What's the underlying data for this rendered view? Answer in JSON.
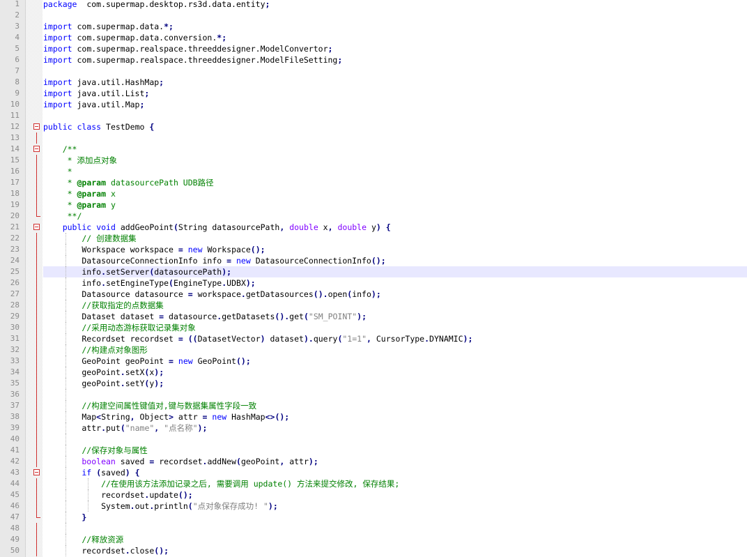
{
  "editor": {
    "current_line": 25,
    "colors": {
      "gutter_bg": "#e8e8e8",
      "current_line_bg": "#e8e8ff",
      "keyword": "#0000ff",
      "type_keyword": "#8000ff",
      "comment": "#008000",
      "string": "#808080",
      "fold_marker": "#d03030"
    },
    "lines": [
      {
        "n": 1,
        "indent": 0,
        "tokens": [
          [
            "kw",
            "package"
          ],
          [
            "",
            "  com.supermap.desktop.rs3d.data.entity"
          ],
          [
            "op",
            ";"
          ]
        ]
      },
      {
        "n": 2,
        "indent": 0,
        "tokens": []
      },
      {
        "n": 3,
        "indent": 0,
        "tokens": [
          [
            "kw",
            "import"
          ],
          [
            "",
            " com.supermap.data."
          ],
          [
            "op",
            "*;"
          ]
        ]
      },
      {
        "n": 4,
        "indent": 0,
        "tokens": [
          [
            "kw",
            "import"
          ],
          [
            "",
            " com.supermap.data.conversion."
          ],
          [
            "op",
            "*;"
          ]
        ]
      },
      {
        "n": 5,
        "indent": 0,
        "tokens": [
          [
            "kw",
            "import"
          ],
          [
            "",
            " com.supermap.realspace.threeddesigner.ModelConvertor"
          ],
          [
            "op",
            ";"
          ]
        ]
      },
      {
        "n": 6,
        "indent": 0,
        "tokens": [
          [
            "kw",
            "import"
          ],
          [
            "",
            " com.supermap.realspace.threeddesigner.ModelFileSetting"
          ],
          [
            "op",
            ";"
          ]
        ]
      },
      {
        "n": 7,
        "indent": 0,
        "tokens": []
      },
      {
        "n": 8,
        "indent": 0,
        "tokens": [
          [
            "kw",
            "import"
          ],
          [
            "",
            " java.util.HashMap"
          ],
          [
            "op",
            ";"
          ]
        ]
      },
      {
        "n": 9,
        "indent": 0,
        "tokens": [
          [
            "kw",
            "import"
          ],
          [
            "",
            " java.util.List"
          ],
          [
            "op",
            ";"
          ]
        ]
      },
      {
        "n": 10,
        "indent": 0,
        "tokens": [
          [
            "kw",
            "import"
          ],
          [
            "",
            " java.util.Map"
          ],
          [
            "op",
            ";"
          ]
        ]
      },
      {
        "n": 11,
        "indent": 0,
        "tokens": []
      },
      {
        "n": 12,
        "indent": 0,
        "fold": "start",
        "tokens": [
          [
            "kw",
            "public"
          ],
          [
            "",
            " "
          ],
          [
            "kw",
            "class"
          ],
          [
            "",
            " TestDemo "
          ],
          [
            "op",
            "{"
          ]
        ]
      },
      {
        "n": 13,
        "indent": 0,
        "fold": "line",
        "tokens": []
      },
      {
        "n": 14,
        "indent": 1,
        "fold": "start",
        "tokens": [
          [
            "cm",
            "    /**"
          ]
        ]
      },
      {
        "n": 15,
        "indent": 1,
        "fold": "line",
        "tokens": [
          [
            "cm",
            "     * 添加点对象"
          ]
        ]
      },
      {
        "n": 16,
        "indent": 1,
        "fold": "line",
        "tokens": [
          [
            "cm",
            "     *"
          ]
        ]
      },
      {
        "n": 17,
        "indent": 1,
        "fold": "line",
        "tokens": [
          [
            "cm",
            "     * "
          ],
          [
            "cmb",
            "@param"
          ],
          [
            "cm",
            " datasourcePath UDB路径"
          ]
        ]
      },
      {
        "n": 18,
        "indent": 1,
        "fold": "line",
        "tokens": [
          [
            "cm",
            "     * "
          ],
          [
            "cmb",
            "@param"
          ],
          [
            "cm",
            " x"
          ]
        ]
      },
      {
        "n": 19,
        "indent": 1,
        "fold": "line",
        "tokens": [
          [
            "cm",
            "     * "
          ],
          [
            "cmb",
            "@param"
          ],
          [
            "cm",
            " y"
          ]
        ]
      },
      {
        "n": 20,
        "indent": 1,
        "fold": "end",
        "tokens": [
          [
            "cm",
            "     **/"
          ]
        ]
      },
      {
        "n": 21,
        "indent": 1,
        "fold": "start",
        "tokens": [
          [
            "",
            ""
          ],
          [
            "kw",
            "    public"
          ],
          [
            "",
            " "
          ],
          [
            "kw",
            "void"
          ],
          [
            "",
            " addGeoPoint"
          ],
          [
            "op",
            "("
          ],
          [
            "",
            "String datasourcePath"
          ],
          [
            "op",
            ","
          ],
          [
            "",
            " "
          ],
          [
            "kw2",
            "double"
          ],
          [
            "",
            " x"
          ],
          [
            "op",
            ","
          ],
          [
            "",
            " "
          ],
          [
            "kw2",
            "double"
          ],
          [
            "",
            " y"
          ],
          [
            "op",
            ")"
          ],
          [
            "",
            " "
          ],
          [
            "op",
            "{"
          ]
        ]
      },
      {
        "n": 22,
        "indent": 2,
        "fold": "line",
        "tokens": [
          [
            "cm",
            "        // 创建数据集"
          ]
        ]
      },
      {
        "n": 23,
        "indent": 2,
        "fold": "line",
        "tokens": [
          [
            "",
            "        Workspace workspace "
          ],
          [
            "op",
            "="
          ],
          [
            "",
            " "
          ],
          [
            "kw",
            "new"
          ],
          [
            "",
            " Workspace"
          ],
          [
            "op",
            "();"
          ]
        ]
      },
      {
        "n": 24,
        "indent": 2,
        "fold": "line",
        "tokens": [
          [
            "",
            "        DatasourceConnectionInfo info "
          ],
          [
            "op",
            "="
          ],
          [
            "",
            " "
          ],
          [
            "kw",
            "new"
          ],
          [
            "",
            " DatasourceConnectionInfo"
          ],
          [
            "op",
            "();"
          ]
        ]
      },
      {
        "n": 25,
        "indent": 2,
        "fold": "line",
        "tokens": [
          [
            "",
            "        info"
          ],
          [
            "op",
            "."
          ],
          [
            "",
            "setServer"
          ],
          [
            "op",
            "("
          ],
          [
            "",
            "datasourcePath"
          ],
          [
            "op",
            ");"
          ]
        ]
      },
      {
        "n": 26,
        "indent": 2,
        "fold": "line",
        "tokens": [
          [
            "",
            "        info"
          ],
          [
            "op",
            "."
          ],
          [
            "",
            "setEngineType"
          ],
          [
            "op",
            "("
          ],
          [
            "",
            "EngineType"
          ],
          [
            "op",
            "."
          ],
          [
            "",
            "UDBX"
          ],
          [
            "op",
            ");"
          ]
        ]
      },
      {
        "n": 27,
        "indent": 2,
        "fold": "line",
        "tokens": [
          [
            "",
            "        Datasource datasource "
          ],
          [
            "op",
            "="
          ],
          [
            "",
            " workspace"
          ],
          [
            "op",
            "."
          ],
          [
            "",
            "getDatasources"
          ],
          [
            "op",
            "()."
          ],
          [
            "",
            "open"
          ],
          [
            "op",
            "("
          ],
          [
            "",
            "info"
          ],
          [
            "op",
            ");"
          ]
        ]
      },
      {
        "n": 28,
        "indent": 2,
        "fold": "line",
        "tokens": [
          [
            "cm",
            "        //获取指定的点数据集"
          ]
        ]
      },
      {
        "n": 29,
        "indent": 2,
        "fold": "line",
        "tokens": [
          [
            "",
            "        Dataset dataset "
          ],
          [
            "op",
            "="
          ],
          [
            "",
            " datasource"
          ],
          [
            "op",
            "."
          ],
          [
            "",
            "getDatasets"
          ],
          [
            "op",
            "()."
          ],
          [
            "",
            "get"
          ],
          [
            "op",
            "("
          ],
          [
            "str",
            "\"SM_POINT\""
          ],
          [
            "op",
            ");"
          ]
        ]
      },
      {
        "n": 30,
        "indent": 2,
        "fold": "line",
        "tokens": [
          [
            "cm",
            "        //采用动态游标获取记录集对象"
          ]
        ]
      },
      {
        "n": 31,
        "indent": 2,
        "fold": "line",
        "tokens": [
          [
            "",
            "        Recordset recordset "
          ],
          [
            "op",
            "="
          ],
          [
            "",
            " "
          ],
          [
            "op",
            "(("
          ],
          [
            "",
            "DatasetVector"
          ],
          [
            "op",
            ")"
          ],
          [
            "",
            " dataset"
          ],
          [
            "op",
            ")."
          ],
          [
            "",
            "query"
          ],
          [
            "op",
            "("
          ],
          [
            "str",
            "\"1=1\""
          ],
          [
            "op",
            ","
          ],
          [
            "",
            " CursorType"
          ],
          [
            "op",
            "."
          ],
          [
            "",
            "DYNAMIC"
          ],
          [
            "op",
            ");"
          ]
        ]
      },
      {
        "n": 32,
        "indent": 2,
        "fold": "line",
        "tokens": [
          [
            "cm",
            "        //构建点对象图形"
          ]
        ]
      },
      {
        "n": 33,
        "indent": 2,
        "fold": "line",
        "tokens": [
          [
            "",
            "        GeoPoint geoPoint "
          ],
          [
            "op",
            "="
          ],
          [
            "",
            " "
          ],
          [
            "kw",
            "new"
          ],
          [
            "",
            " GeoPoint"
          ],
          [
            "op",
            "();"
          ]
        ]
      },
      {
        "n": 34,
        "indent": 2,
        "fold": "line",
        "tokens": [
          [
            "",
            "        geoPoint"
          ],
          [
            "op",
            "."
          ],
          [
            "",
            "setX"
          ],
          [
            "op",
            "("
          ],
          [
            "",
            "x"
          ],
          [
            "op",
            ");"
          ]
        ]
      },
      {
        "n": 35,
        "indent": 2,
        "fold": "line",
        "tokens": [
          [
            "",
            "        geoPoint"
          ],
          [
            "op",
            "."
          ],
          [
            "",
            "setY"
          ],
          [
            "op",
            "("
          ],
          [
            "",
            "y"
          ],
          [
            "op",
            ");"
          ]
        ]
      },
      {
        "n": 36,
        "indent": 2,
        "fold": "line",
        "tokens": []
      },
      {
        "n": 37,
        "indent": 2,
        "fold": "line",
        "tokens": [
          [
            "cm",
            "        //构建空间属性键值对,键与数据集属性字段一致"
          ]
        ]
      },
      {
        "n": 38,
        "indent": 2,
        "fold": "line",
        "tokens": [
          [
            "",
            "        Map"
          ],
          [
            "op",
            "<"
          ],
          [
            "",
            "String"
          ],
          [
            "op",
            ","
          ],
          [
            "",
            " Object"
          ],
          [
            "op",
            ">"
          ],
          [
            "",
            " attr "
          ],
          [
            "op",
            "="
          ],
          [
            "",
            " "
          ],
          [
            "kw",
            "new"
          ],
          [
            "",
            " HashMap"
          ],
          [
            "op",
            "<>();"
          ]
        ]
      },
      {
        "n": 39,
        "indent": 2,
        "fold": "line",
        "tokens": [
          [
            "",
            "        attr"
          ],
          [
            "op",
            "."
          ],
          [
            "",
            "put"
          ],
          [
            "op",
            "("
          ],
          [
            "str",
            "\"name\""
          ],
          [
            "op",
            ","
          ],
          [
            "",
            " "
          ],
          [
            "str",
            "\"点名称\""
          ],
          [
            "op",
            ");"
          ]
        ]
      },
      {
        "n": 40,
        "indent": 2,
        "fold": "line",
        "tokens": []
      },
      {
        "n": 41,
        "indent": 2,
        "fold": "line",
        "tokens": [
          [
            "cm",
            "        //保存对象与属性"
          ]
        ]
      },
      {
        "n": 42,
        "indent": 2,
        "fold": "line",
        "tokens": [
          [
            "kw2",
            "        boolean"
          ],
          [
            "",
            " saved "
          ],
          [
            "op",
            "="
          ],
          [
            "",
            " recordset"
          ],
          [
            "op",
            "."
          ],
          [
            "",
            "addNew"
          ],
          [
            "op",
            "("
          ],
          [
            "",
            "geoPoint"
          ],
          [
            "op",
            ","
          ],
          [
            "",
            " attr"
          ],
          [
            "op",
            ");"
          ]
        ]
      },
      {
        "n": 43,
        "indent": 2,
        "fold": "start",
        "tokens": [
          [
            "kw",
            "        if"
          ],
          [
            "",
            " "
          ],
          [
            "op",
            "("
          ],
          [
            "",
            "saved"
          ],
          [
            "op",
            ")"
          ],
          [
            "",
            " "
          ],
          [
            "op",
            "{"
          ]
        ]
      },
      {
        "n": 44,
        "indent": 3,
        "fold": "line",
        "tokens": [
          [
            "cm",
            "            //在使用该方法添加记录之后, 需要调用 update() 方法来提交修改, 保存结果;"
          ]
        ]
      },
      {
        "n": 45,
        "indent": 3,
        "fold": "line",
        "tokens": [
          [
            "",
            "            recordset"
          ],
          [
            "op",
            "."
          ],
          [
            "",
            "update"
          ],
          [
            "op",
            "();"
          ]
        ]
      },
      {
        "n": 46,
        "indent": 3,
        "fold": "line",
        "tokens": [
          [
            "",
            "            System"
          ],
          [
            "op",
            "."
          ],
          [
            "",
            "out"
          ],
          [
            "op",
            "."
          ],
          [
            "",
            "println"
          ],
          [
            "op",
            "("
          ],
          [
            "str",
            "\"点对象保存成功! \""
          ],
          [
            "op",
            ");"
          ]
        ]
      },
      {
        "n": 47,
        "indent": 2,
        "fold": "end",
        "tokens": [
          [
            "op",
            "        }"
          ]
        ]
      },
      {
        "n": 48,
        "indent": 2,
        "fold": "line",
        "tokens": []
      },
      {
        "n": 49,
        "indent": 2,
        "fold": "line",
        "tokens": [
          [
            "cm",
            "        //释放资源"
          ]
        ]
      },
      {
        "n": 50,
        "indent": 2,
        "fold": "line",
        "tokens": [
          [
            "",
            "        recordset"
          ],
          [
            "op",
            "."
          ],
          [
            "",
            "close"
          ],
          [
            "op",
            "();"
          ]
        ]
      }
    ]
  }
}
